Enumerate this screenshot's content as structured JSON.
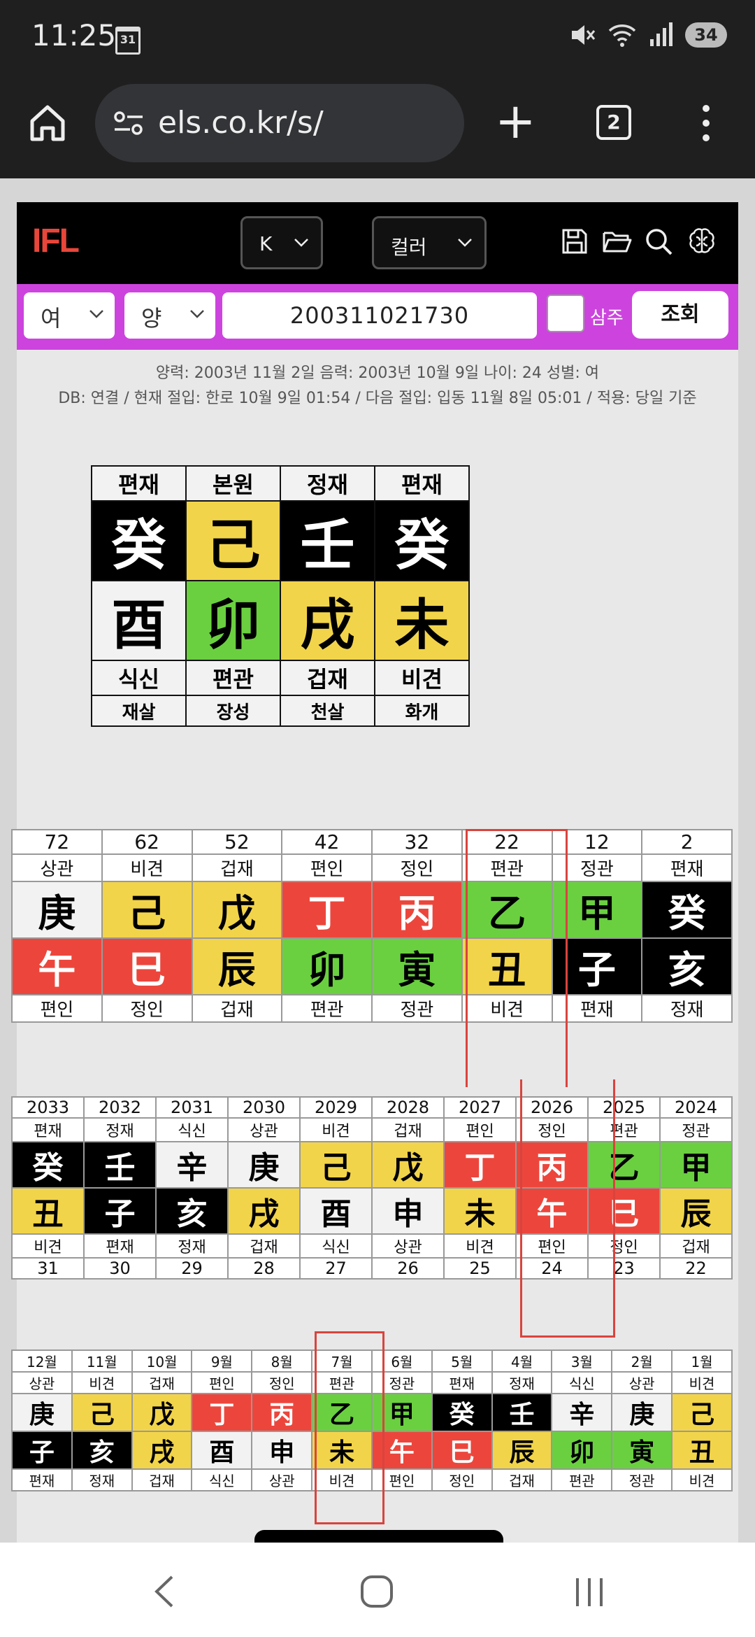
{
  "status": {
    "time": "11:25",
    "calendar_day": "31",
    "battery": "34"
  },
  "browser": {
    "url": "els.co.kr/s/",
    "tab_count": "2"
  },
  "toolbar": {
    "logo": "IFL",
    "lang": "K",
    "theme": "컬러"
  },
  "form": {
    "gender": "여",
    "calendar": "양",
    "birth": "200311021730",
    "samju_label": "삼주",
    "search_label": "조회"
  },
  "info": {
    "line1": "양력: 2003년 11월 2일   음력: 2003년 10월 9일   나이: 24   성별: 여",
    "line2": "DB: 연결 / 현재 절입: 한로 10월 9일 01:54 / 다음 절입: 입동 11월 8일 05:01 / 적용: 당일 기준"
  },
  "pillars": {
    "top": [
      "편재",
      "본원",
      "정재",
      "편재"
    ],
    "stems": [
      {
        "c": "癸",
        "color": "b"
      },
      {
        "c": "己",
        "color": "y"
      },
      {
        "c": "壬",
        "color": "b"
      },
      {
        "c": "癸",
        "color": "b"
      }
    ],
    "branches": [
      {
        "c": "酉",
        "color": "w"
      },
      {
        "c": "卯",
        "color": "g"
      },
      {
        "c": "戌",
        "color": "y"
      },
      {
        "c": "未",
        "color": "y"
      }
    ],
    "bottom": [
      "식신",
      "편관",
      "겁재",
      "비견"
    ],
    "extra": [
      "재살",
      "장성",
      "천살",
      "화개"
    ]
  },
  "daeun": {
    "ages": [
      "72",
      "62",
      "52",
      "42",
      "32",
      "22",
      "12",
      "2"
    ],
    "top": [
      "상관",
      "비견",
      "겁재",
      "편인",
      "정인",
      "편관",
      "정관",
      "편재"
    ],
    "stems": [
      {
        "c": "庚",
        "color": "w"
      },
      {
        "c": "己",
        "color": "y"
      },
      {
        "c": "戊",
        "color": "y"
      },
      {
        "c": "丁",
        "color": "r"
      },
      {
        "c": "丙",
        "color": "r"
      },
      {
        "c": "乙",
        "color": "g"
      },
      {
        "c": "甲",
        "color": "g"
      },
      {
        "c": "癸",
        "color": "b"
      }
    ],
    "branches": [
      {
        "c": "午",
        "color": "r"
      },
      {
        "c": "巳",
        "color": "r"
      },
      {
        "c": "辰",
        "color": "y"
      },
      {
        "c": "卯",
        "color": "g"
      },
      {
        "c": "寅",
        "color": "g"
      },
      {
        "c": "丑",
        "color": "y"
      },
      {
        "c": "子",
        "color": "b"
      },
      {
        "c": "亥",
        "color": "b"
      }
    ],
    "bottom": [
      "편인",
      "정인",
      "겁재",
      "편관",
      "정관",
      "비견",
      "편재",
      "정재"
    ]
  },
  "yearly": {
    "years": [
      "2033",
      "2032",
      "2031",
      "2030",
      "2029",
      "2028",
      "2027",
      "2026",
      "2025",
      "2024"
    ],
    "top": [
      "편재",
      "정재",
      "식신",
      "상관",
      "비견",
      "겁재",
      "편인",
      "정인",
      "편관",
      "정관"
    ],
    "stems": [
      {
        "c": "癸",
        "color": "b"
      },
      {
        "c": "壬",
        "color": "b"
      },
      {
        "c": "辛",
        "color": "w"
      },
      {
        "c": "庚",
        "color": "w"
      },
      {
        "c": "己",
        "color": "y"
      },
      {
        "c": "戊",
        "color": "y"
      },
      {
        "c": "丁",
        "color": "r"
      },
      {
        "c": "丙",
        "color": "r"
      },
      {
        "c": "乙",
        "color": "g"
      },
      {
        "c": "甲",
        "color": "g"
      }
    ],
    "branches": [
      {
        "c": "丑",
        "color": "y"
      },
      {
        "c": "子",
        "color": "b"
      },
      {
        "c": "亥",
        "color": "b"
      },
      {
        "c": "戌",
        "color": "y"
      },
      {
        "c": "酉",
        "color": "w"
      },
      {
        "c": "申",
        "color": "w"
      },
      {
        "c": "未",
        "color": "y"
      },
      {
        "c": "午",
        "color": "r"
      },
      {
        "c": "巳",
        "color": "r"
      },
      {
        "c": "辰",
        "color": "y"
      }
    ],
    "bottom": [
      "비견",
      "편재",
      "정재",
      "겁재",
      "식신",
      "상관",
      "비견",
      "편인",
      "정인",
      "겁재"
    ],
    "ages": [
      "31",
      "30",
      "29",
      "28",
      "27",
      "26",
      "25",
      "24",
      "23",
      "22"
    ]
  },
  "monthly": {
    "months": [
      "12월",
      "11월",
      "10월",
      "9월",
      "8월",
      "7월",
      "6월",
      "5월",
      "4월",
      "3월",
      "2월",
      "1월"
    ],
    "top": [
      "상관",
      "비견",
      "겁재",
      "편인",
      "정인",
      "편관",
      "정관",
      "편재",
      "정재",
      "식신",
      "상관",
      "비견"
    ],
    "stems": [
      {
        "c": "庚",
        "color": "w"
      },
      {
        "c": "己",
        "color": "y"
      },
      {
        "c": "戊",
        "color": "y"
      },
      {
        "c": "丁",
        "color": "r"
      },
      {
        "c": "丙",
        "color": "r"
      },
      {
        "c": "乙",
        "color": "g"
      },
      {
        "c": "甲",
        "color": "g"
      },
      {
        "c": "癸",
        "color": "b"
      },
      {
        "c": "壬",
        "color": "b"
      },
      {
        "c": "辛",
        "color": "w"
      },
      {
        "c": "庚",
        "color": "w"
      },
      {
        "c": "己",
        "color": "y"
      }
    ],
    "branches": [
      {
        "c": "子",
        "color": "b"
      },
      {
        "c": "亥",
        "color": "b"
      },
      {
        "c": "戌",
        "color": "y"
      },
      {
        "c": "酉",
        "color": "w"
      },
      {
        "c": "申",
        "color": "w"
      },
      {
        "c": "未",
        "color": "y"
      },
      {
        "c": "午",
        "color": "r"
      },
      {
        "c": "巳",
        "color": "r"
      },
      {
        "c": "辰",
        "color": "y"
      },
      {
        "c": "卯",
        "color": "g"
      },
      {
        "c": "寅",
        "color": "g"
      },
      {
        "c": "丑",
        "color": "y"
      }
    ],
    "bottom": [
      "편재",
      "정재",
      "겁재",
      "식신",
      "상관",
      "비견",
      "편인",
      "정인",
      "겁재",
      "편관",
      "정관",
      "비견"
    ]
  }
}
